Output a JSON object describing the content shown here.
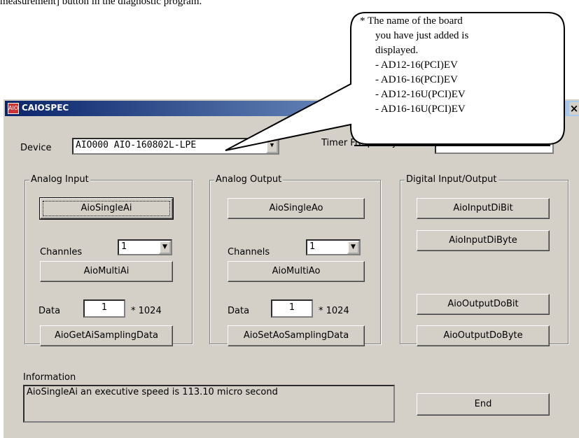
{
  "doc": {
    "top_text": "measurement] button in the diagnostic program."
  },
  "window": {
    "title": "CAIOSPEC",
    "close_glyph": "×",
    "app_icon": "AIO"
  },
  "device": {
    "label": "Device",
    "value": "AIO000 AIO-160802L-LPE",
    "timer_label": "Timer Frequency"
  },
  "analog_input": {
    "legend": "Analog Input",
    "single_button": "AioSingleAi",
    "channels_label": "Channles",
    "channels_value": "1",
    "multi_button": "AioMultiAi",
    "data_label": "Data",
    "data_value": "1",
    "data_suffix": "* 1024",
    "sampling_button": "AioGetAiSamplingData"
  },
  "analog_output": {
    "legend": "Analog Output",
    "single_button": "AioSingleAo",
    "channels_label": "Channels",
    "channels_value": "1",
    "multi_button": "AioMultiAo",
    "data_label": "Data",
    "data_value": "1",
    "data_suffix": "* 1024",
    "sampling_button": "AioSetAoSamplingData"
  },
  "digital_io": {
    "legend": "Digital Input/Output",
    "input_bit_button": "AioInputDiBit",
    "input_byte_button": "AioInputDiByte",
    "output_bit_button": "AioOutputDoBit",
    "output_byte_button": "AioOutputDoByte"
  },
  "information": {
    "label": "Information",
    "text": "AioSingleAi an executive speed is 113.10 micro second"
  },
  "end_button": "End",
  "callout": {
    "line1": "* The name of the board",
    "line2": "you have just added is",
    "line3": "displayed.",
    "boards": [
      "- AD12-16(PCI)EV",
      "- AD16-16(PCI)EV",
      "- AD12-16U(PCI)EV",
      "- AD16-16U(PCI)EV"
    ]
  }
}
